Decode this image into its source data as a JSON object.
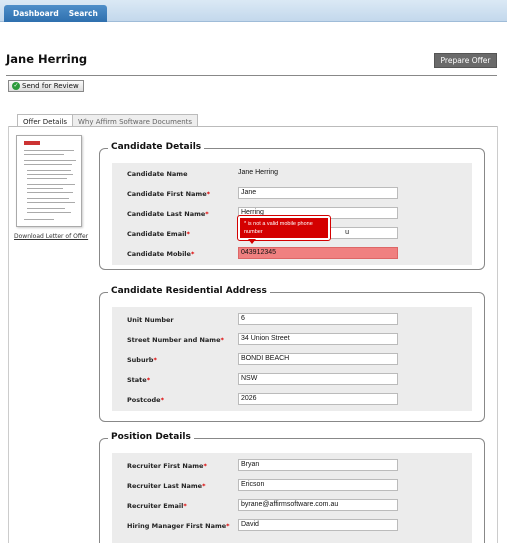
{
  "nav": {
    "tabs": [
      "Dashboard",
      "Search"
    ]
  },
  "page": {
    "title": "Jane Herring",
    "prepare_offer": "Prepare Offer",
    "send_for_review": "Send for Review"
  },
  "tabs": [
    "Offer Details",
    "Why Affirm Software Documents"
  ],
  "sidebar": {
    "download_link": "Download Letter of Offer"
  },
  "candidate": {
    "legend": "Candidate Details",
    "name_label": "Candidate Name",
    "name_value": "Jane Herring",
    "first_label": "Candidate First Name",
    "first_value": "Jane",
    "last_label": "Candidate Last Name",
    "last_value": "Herring",
    "email_label": "Candidate Email",
    "email_value": "u",
    "mobile_label": "Candidate Mobile",
    "mobile_value": "043912345",
    "mobile_error": "* is not a valid mobile phone number",
    "required_mark": "*"
  },
  "address": {
    "legend": "Candidate Residential Address",
    "unit_label": "Unit Number",
    "unit_value": "6",
    "street_label": "Street Number and Name",
    "street_value": "34 Union Street",
    "suburb_label": "Suburb",
    "suburb_value": "BONDI BEACH",
    "state_label": "State",
    "state_value": "NSW",
    "postcode_label": "Postcode",
    "postcode_value": "2026"
  },
  "position": {
    "legend": "Position Details",
    "rfirst_label": "Recruiter First Name",
    "rfirst_value": "Bryan",
    "rlast_label": "Recruiter Last Name",
    "rlast_value": "Ericson",
    "remail_label": "Recruiter Email",
    "remail_value": "byrane@affirmsoftware.com.au",
    "hfirst_label": "Hiring Manager First Name",
    "hfirst_value": "David"
  }
}
